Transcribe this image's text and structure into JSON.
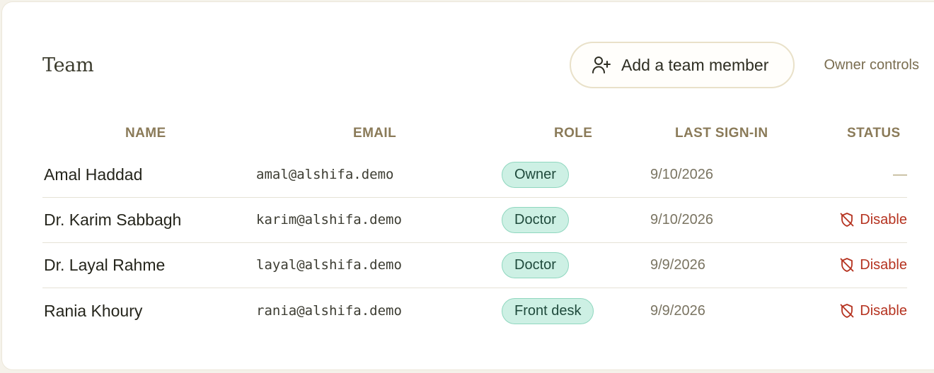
{
  "header": {
    "title": "Team",
    "add_member_label": "Add a team member",
    "owner_controls_label": "Owner controls"
  },
  "table": {
    "columns": [
      "NAME",
      "EMAIL",
      "ROLE",
      "LAST SIGN-IN",
      "STATUS"
    ],
    "rows": [
      {
        "name": "Amal Haddad",
        "email": "amal@alshifa.demo",
        "role": "Owner",
        "last_sign_in": "9/10/2026",
        "status": "—"
      },
      {
        "name": "Dr. Karim Sabbagh",
        "email": "karim@alshifa.demo",
        "role": "Doctor",
        "last_sign_in": "9/10/2026",
        "status": "Disable"
      },
      {
        "name": "Dr. Layal Rahme",
        "email": "layal@alshifa.demo",
        "role": "Doctor",
        "last_sign_in": "9/9/2026",
        "status": "Disable"
      },
      {
        "name": "Rania Khoury",
        "email": "rania@alshifa.demo",
        "role": "Front desk",
        "last_sign_in": "9/9/2026",
        "status": "Disable"
      }
    ]
  },
  "icons": {
    "add_member": "user-plus-icon",
    "disable": "shield-off-icon"
  },
  "colors": {
    "role_pill_bg": "#cdf0e4",
    "disable_text": "#b5321f",
    "header_text": "#8a7a58"
  }
}
